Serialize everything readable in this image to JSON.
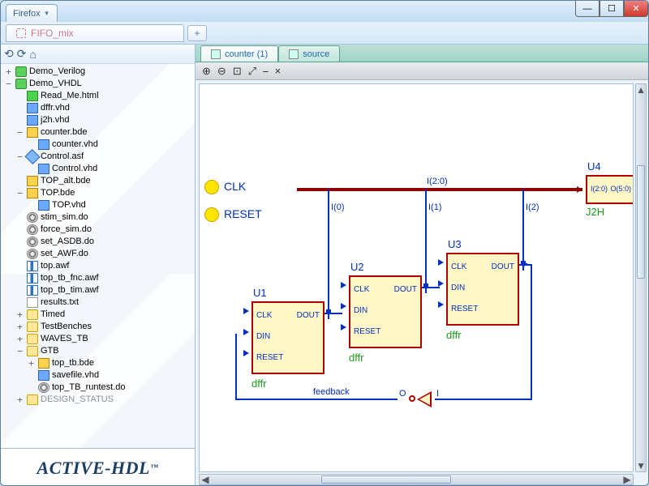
{
  "browser": {
    "name": "Firefox"
  },
  "doc_tabs": {
    "current": "FIFO_mix",
    "new_tab_glyph": "+"
  },
  "win_controls": {
    "min": "—",
    "max": "☐",
    "close": "✕"
  },
  "sidebar_tools": {
    "a": "⟲",
    "b": "⟳",
    "home": "⌂"
  },
  "tree": [
    {
      "d": 0,
      "tw": "+",
      "ic": "lib",
      "t": "Demo_Verilog"
    },
    {
      "d": 0,
      "tw": "−",
      "ic": "lib",
      "t": "Demo_VHDL"
    },
    {
      "d": 1,
      "tw": "",
      "ic": "html",
      "t": "Read_Me.html"
    },
    {
      "d": 1,
      "tw": "",
      "ic": "vhd",
      "t": "dffr.vhd"
    },
    {
      "d": 1,
      "tw": "",
      "ic": "vhd",
      "t": "j2h.vhd"
    },
    {
      "d": 1,
      "tw": "−",
      "ic": "bde",
      "t": "counter.bde"
    },
    {
      "d": 2,
      "tw": "",
      "ic": "vhd",
      "t": "counter.vhd"
    },
    {
      "d": 1,
      "tw": "−",
      "ic": "asf",
      "t": "Control.asf"
    },
    {
      "d": 2,
      "tw": "",
      "ic": "vhd",
      "t": "Control.vhd"
    },
    {
      "d": 1,
      "tw": "",
      "ic": "bde",
      "t": "TOP_alt.bde"
    },
    {
      "d": 1,
      "tw": "−",
      "ic": "bde",
      "t": "TOP.bde"
    },
    {
      "d": 2,
      "tw": "",
      "ic": "vhd",
      "t": "TOP.vhd"
    },
    {
      "d": 1,
      "tw": "",
      "ic": "sim",
      "t": "stim_sim.do"
    },
    {
      "d": 1,
      "tw": "",
      "ic": "sim",
      "t": "force_sim.do"
    },
    {
      "d": 1,
      "tw": "",
      "ic": "sim",
      "t": "set_ASDB.do"
    },
    {
      "d": 1,
      "tw": "",
      "ic": "sim",
      "t": "set_AWF.do"
    },
    {
      "d": 1,
      "tw": "",
      "ic": "awf",
      "t": "top.awf"
    },
    {
      "d": 1,
      "tw": "",
      "ic": "awf",
      "t": "top_tb_fnc.awf"
    },
    {
      "d": 1,
      "tw": "",
      "ic": "awf",
      "t": "top_tb_tim.awf"
    },
    {
      "d": 1,
      "tw": "",
      "ic": "txt",
      "t": "results.txt"
    },
    {
      "d": 1,
      "tw": "+",
      "ic": "folder",
      "t": "Timed"
    },
    {
      "d": 1,
      "tw": "+",
      "ic": "folder",
      "t": "TestBenches"
    },
    {
      "d": 1,
      "tw": "+",
      "ic": "folder",
      "t": "WAVES_TB"
    },
    {
      "d": 1,
      "tw": "−",
      "ic": "folder",
      "t": "GTB"
    },
    {
      "d": 2,
      "tw": "+",
      "ic": "bde",
      "t": "top_tb.bde"
    },
    {
      "d": 2,
      "tw": "",
      "ic": "vhd",
      "t": "savefile.vhd"
    },
    {
      "d": 2,
      "tw": "",
      "ic": "sim",
      "t": "top_TB_runtest.do"
    },
    {
      "d": 1,
      "tw": "+",
      "ic": "folder",
      "t": "DESIGN_STATUS",
      "gray": true
    }
  ],
  "logo": "ACTIVE-HDL",
  "logo_tm": "™",
  "inner_tabs": {
    "t1": "counter (1)",
    "t2": "source"
  },
  "canvas_tools": {
    "zoom_in": "⊕",
    "zoom_out": "⊖",
    "zoom_area": "⊡",
    "fit": "⤢",
    "sep": "⎯",
    "close": "×"
  },
  "schematic": {
    "inputs": {
      "clk": "CLK",
      "reset": "RESET"
    },
    "bus_label": "I(2:0)",
    "taps": {
      "i0": "I(0)",
      "i1": "I(1)",
      "i2": "I(2)"
    },
    "blocks": {
      "u1": {
        "inst": "U1",
        "type": "dffr",
        "ports": [
          "CLK",
          "DIN",
          "RESET"
        ],
        "out": "DOUT"
      },
      "u2": {
        "inst": "U2",
        "type": "dffr",
        "ports": [
          "CLK",
          "DIN",
          "RESET"
        ],
        "out": "DOUT"
      },
      "u3": {
        "inst": "U3",
        "type": "dffr",
        "ports": [
          "CLK",
          "DIN",
          "RESET"
        ],
        "out": "DOUT"
      },
      "u4": {
        "inst": "U4",
        "type": "J2H",
        "in": "I(2:0)",
        "out": "O(5:0)"
      }
    },
    "feedback": "feedback",
    "inv_ports": {
      "o": "O",
      "i": "I"
    }
  }
}
